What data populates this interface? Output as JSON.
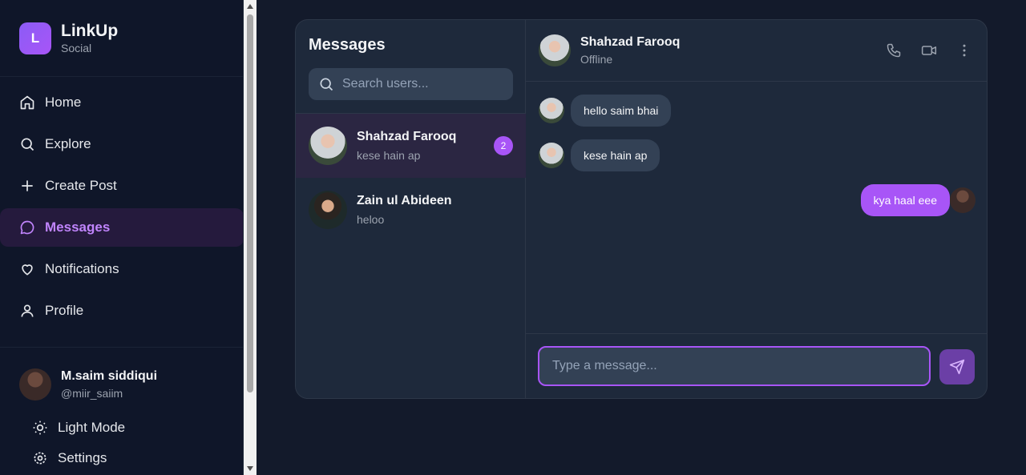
{
  "brand": {
    "logo_letter": "L",
    "name": "LinkUp",
    "subtitle": "Social"
  },
  "nav": {
    "items": [
      {
        "label": "Home",
        "icon": "home-icon"
      },
      {
        "label": "Explore",
        "icon": "search-icon"
      },
      {
        "label": "Create Post",
        "icon": "plus-icon"
      },
      {
        "label": "Messages",
        "icon": "chat-icon",
        "active": true
      },
      {
        "label": "Notifications",
        "icon": "heart-icon"
      },
      {
        "label": "Profile",
        "icon": "user-icon"
      }
    ]
  },
  "current_user": {
    "name": "M.saim siddiqui",
    "handle": "@miir_saiim"
  },
  "theme_toggle": {
    "label": "Light Mode",
    "icon": "sun-icon"
  },
  "settings_peek": {
    "label": "Settings",
    "icon": "gear-icon"
  },
  "messages_panel": {
    "title": "Messages",
    "search_placeholder": "Search users...",
    "conversations": [
      {
        "name": "Shahzad Farooq",
        "last_message": "kese hain ap",
        "unread": "2",
        "active": true
      },
      {
        "name": "Zain ul Abideen",
        "last_message": "heloo"
      }
    ]
  },
  "chat": {
    "contact_name": "Shahzad Farooq",
    "contact_status": "Offline",
    "messages": [
      {
        "text": "hello saim bhai",
        "direction": "in"
      },
      {
        "text": "kese hain ap",
        "direction": "in"
      },
      {
        "text": "kya haal eee",
        "direction": "out"
      }
    ],
    "input_placeholder": "Type a message..."
  },
  "colors": {
    "accent": "#a855f7",
    "background": "#131a2b",
    "sidebar": "#0f1629",
    "panel": "#1e293b"
  }
}
